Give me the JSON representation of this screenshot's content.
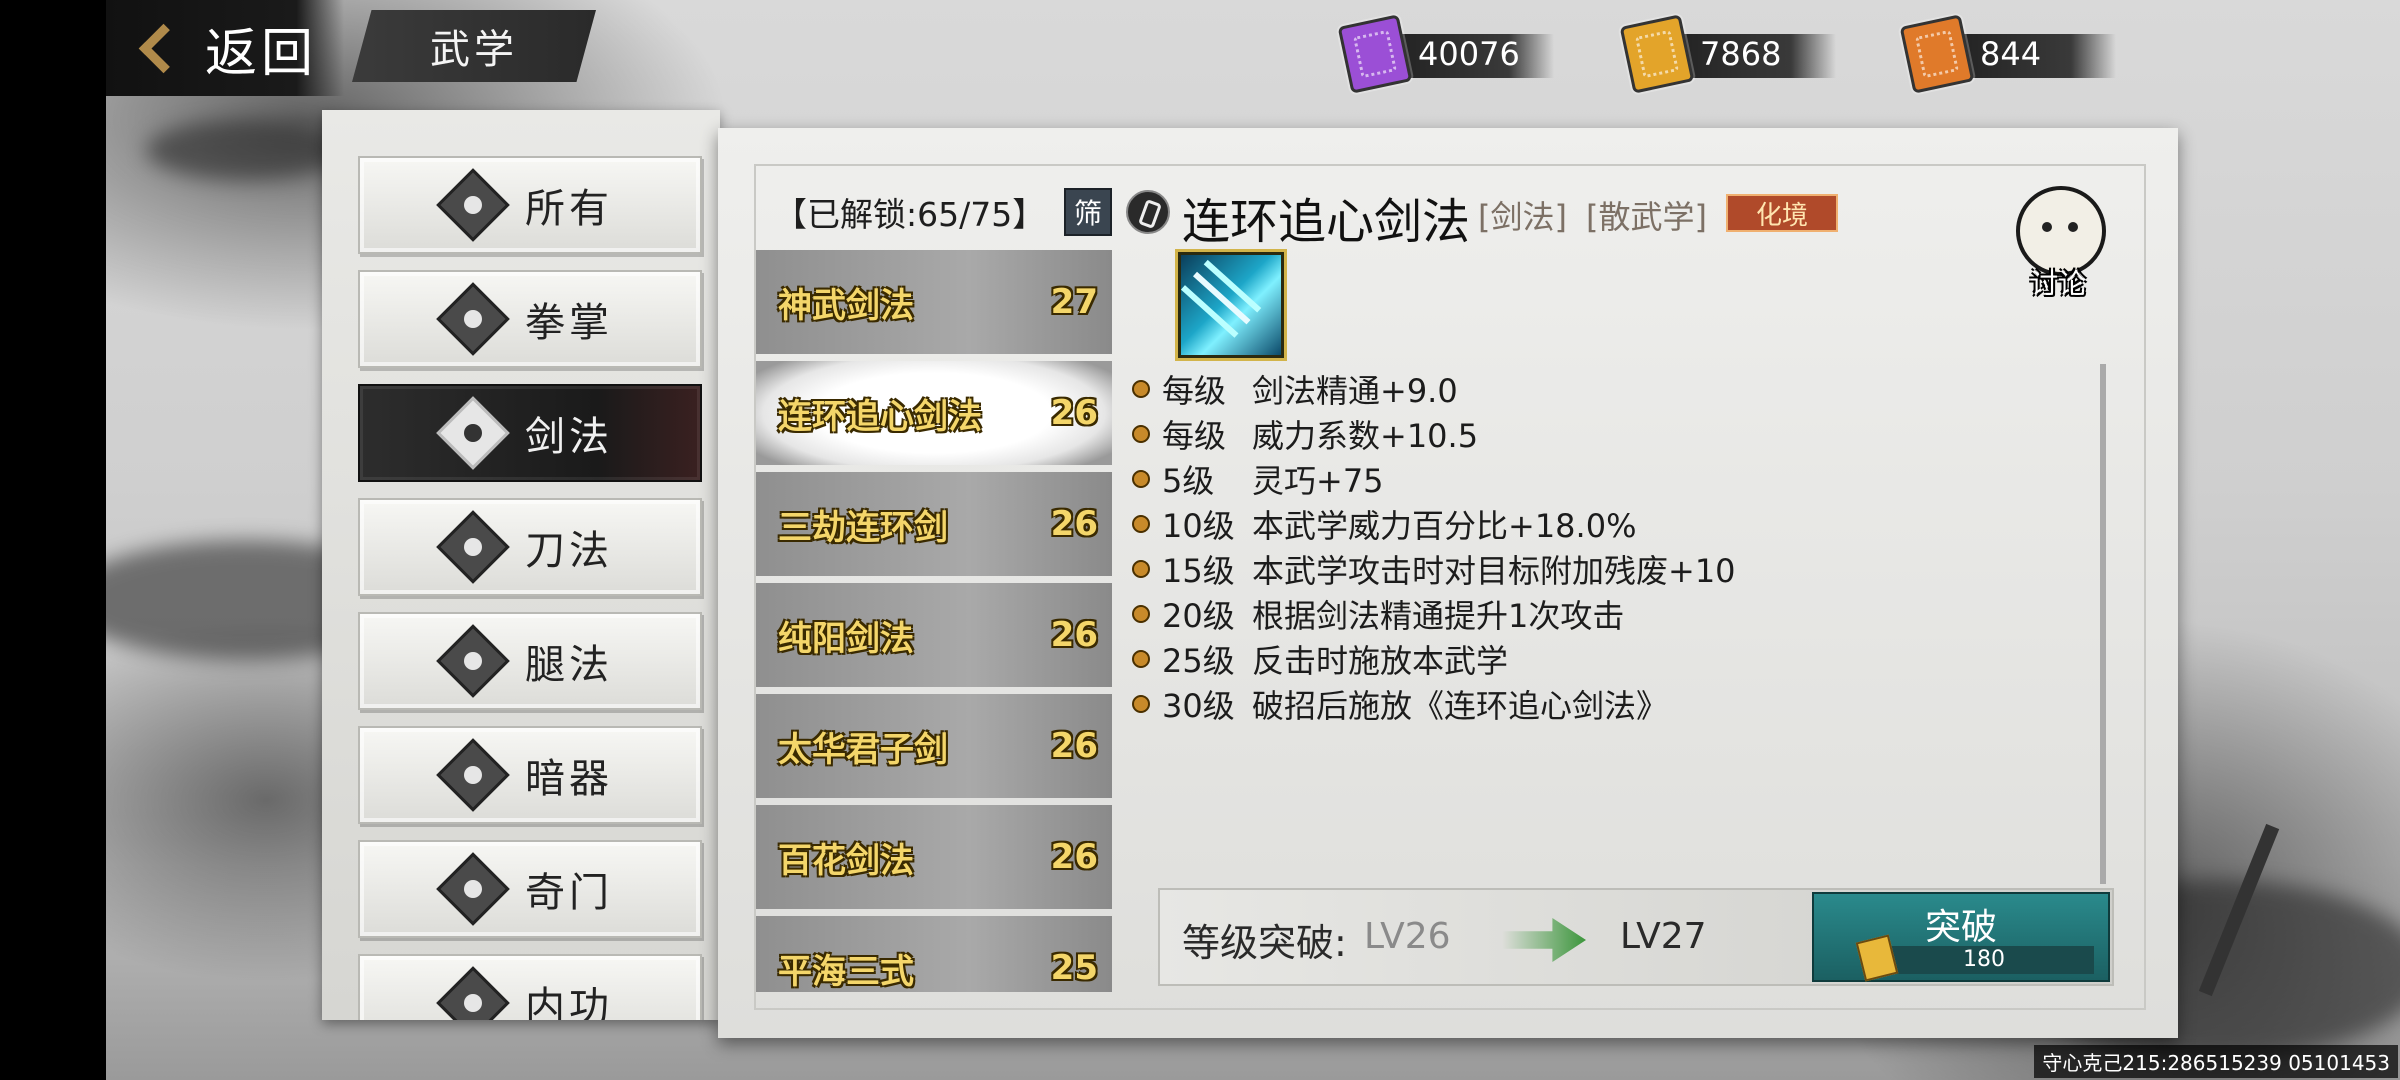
{
  "header": {
    "back_label": "返回",
    "page_title": "武学"
  },
  "currencies": [
    {
      "value": "40076",
      "color": "#9b4fd6",
      "icon": "purple-scroll-icon"
    },
    {
      "value": "7868",
      "color": "#e3a42a",
      "icon": "gold-scroll-icon"
    },
    {
      "value": "844",
      "color": "#e07a2a",
      "icon": "orange-scroll-icon"
    }
  ],
  "categories": [
    {
      "label": "所有",
      "icon": "all-icon",
      "active": false
    },
    {
      "label": "拳掌",
      "icon": "fist-icon",
      "active": false
    },
    {
      "label": "剑法",
      "icon": "sword-icon",
      "active": true
    },
    {
      "label": "刀法",
      "icon": "blade-icon",
      "active": false
    },
    {
      "label": "腿法",
      "icon": "kick-icon",
      "active": false
    },
    {
      "label": "暗器",
      "icon": "shuriken-icon",
      "active": false
    },
    {
      "label": "奇门",
      "icon": "scroll-icon",
      "active": false
    },
    {
      "label": "内功",
      "icon": "inner-power-icon",
      "active": false
    }
  ],
  "skill_list": {
    "unlocked": "【已解锁:65/75】",
    "filter_label": "筛",
    "items": [
      {
        "name": "神武剑法",
        "level": "27"
      },
      {
        "name": "连环追心剑法",
        "level": "26",
        "selected": true
      },
      {
        "name": "三劫连环剑",
        "level": "26"
      },
      {
        "name": "纯阳剑法",
        "level": "26"
      },
      {
        "name": "太华君子剑",
        "level": "26"
      },
      {
        "name": "百花剑法",
        "level": "26"
      },
      {
        "name": "平海三式",
        "level": "25"
      }
    ]
  },
  "detail": {
    "title": "连环追心剑法",
    "tag_type": "[剑法]",
    "tag_school": "[散武学]",
    "realm": "化境",
    "discuss_label": "讨论",
    "effects": [
      {
        "level": "每级",
        "text": "剑法精通+9.0"
      },
      {
        "level": "每级",
        "text": "威力系数+10.5"
      },
      {
        "level": "5级",
        "text": "灵巧+75"
      },
      {
        "level": "10级",
        "text": "本武学威力百分比+18.0%"
      },
      {
        "level": "15级",
        "text": "本武学攻击时对目标附加残废+10"
      },
      {
        "level": "20级",
        "text": "根据剑法精通提升1次攻击"
      },
      {
        "level": "25级",
        "text": "反击时施放本武学"
      },
      {
        "level": "30级",
        "text": "破招后施放《连环追心剑法》"
      }
    ]
  },
  "breakthrough": {
    "label": "等级突破:",
    "from_level": "LV26",
    "to_level": "LV27",
    "button_label": "突破",
    "cost": "180"
  },
  "footer": {
    "player_id": "守心克己215:286515239 05101453"
  }
}
